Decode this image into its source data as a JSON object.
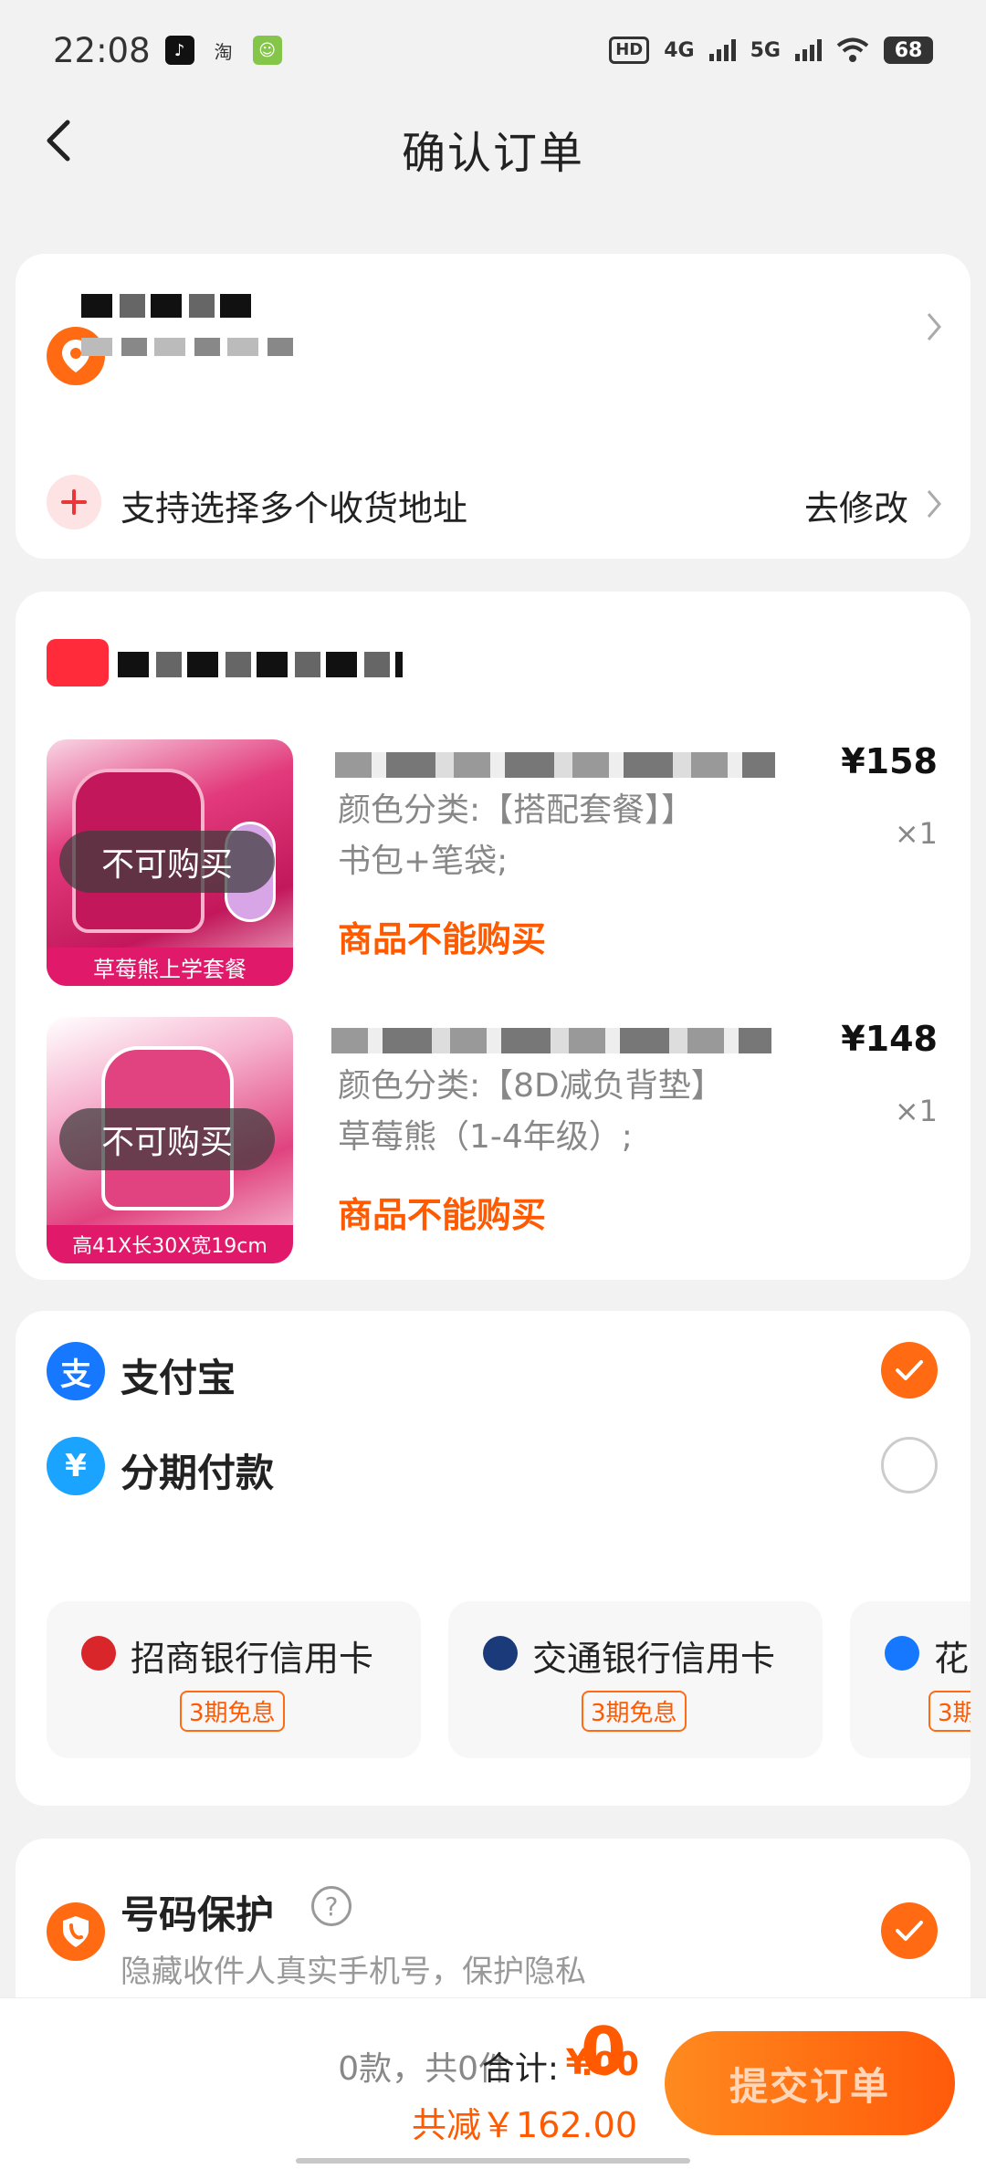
{
  "status_bar": {
    "time": "22:08",
    "icons": [
      "tiktok-icon",
      "taobao-icon",
      "face-app-icon",
      "hd-icon",
      "signal-4g-icon",
      "signal-5g-icon",
      "wifi-icon"
    ],
    "hd_label": "HD",
    "net1": "4G",
    "net2": "5G",
    "battery": "68",
    "taobao_glyph": "淘"
  },
  "header": {
    "title": "确认订单",
    "back_icon": "chevron-left-icon"
  },
  "address": {
    "icon": "location-pin-icon",
    "multi_address_label": "支持选择多个收货地址",
    "modify_label": "去修改"
  },
  "products": [
    {
      "image_banner": "草莓熊上学套餐",
      "overlay": "不可购买",
      "price": "¥158",
      "quantity": "×1",
      "spec_line1": "颜色分类:【搭配套餐】】",
      "spec_line2": "书包+笔袋;",
      "status": "商品不能购买"
    },
    {
      "image_banner": "高41X长30X宽19cm",
      "overlay": "不可购买",
      "price": "¥148",
      "quantity": "×1",
      "spec_line1": "颜色分类:【8D减负背垫】",
      "spec_line2": "草莓熊（1-4年级）;",
      "status": "商品不能购买"
    }
  ],
  "payment": {
    "alipay_label": "支付宝",
    "alipay_icon_glyph": "支",
    "installment_label": "分期付款",
    "installment_icon_glyph": "¥",
    "installment_options": [
      {
        "bank": "招商银行信用卡",
        "badge": "3期免息"
      },
      {
        "bank": "交通银行信用卡",
        "badge": "3期免息"
      },
      {
        "bank": "花",
        "badge": "3期"
      }
    ]
  },
  "privacy": {
    "title": "号码保护",
    "help_glyph": "?",
    "description": "隐藏收件人真实手机号，保护隐私"
  },
  "bottom_bar": {
    "count_text": "0款，共0件",
    "total_label": "合计:",
    "currency": "¥",
    "total_integer": "0",
    "total_decimal": ".00",
    "discount_text": "共减￥162.00",
    "submit_label": "提交订单"
  },
  "colors": {
    "accent": "#ff6a13",
    "alipay_blue": "#1677ff",
    "installment_blue": "#1aa3ff",
    "warning_text": "#ff5a00"
  }
}
